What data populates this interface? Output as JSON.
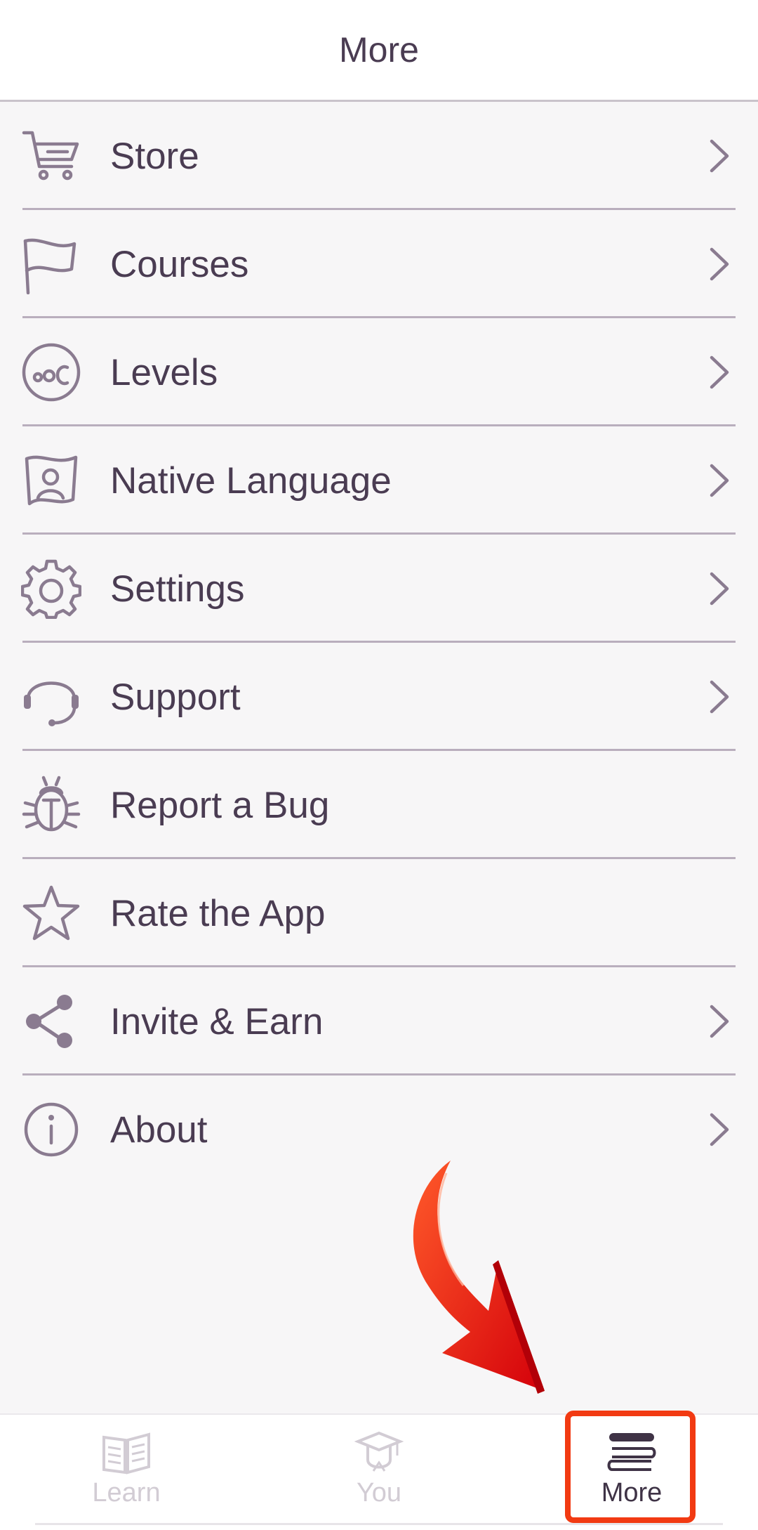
{
  "header": {
    "title": "More"
  },
  "menu": [
    {
      "label": "Store",
      "icon": "cart-icon",
      "chevron": true
    },
    {
      "label": "Courses",
      "icon": "flag-icon",
      "chevron": true
    },
    {
      "label": "Levels",
      "icon": "levels-icon",
      "chevron": true
    },
    {
      "label": "Native Language",
      "icon": "native-language-icon",
      "chevron": true
    },
    {
      "label": "Settings",
      "icon": "gear-icon",
      "chevron": true
    },
    {
      "label": "Support",
      "icon": "headset-icon",
      "chevron": true
    },
    {
      "label": "Report a Bug",
      "icon": "bug-icon",
      "chevron": false
    },
    {
      "label": "Rate the App",
      "icon": "star-icon",
      "chevron": false
    },
    {
      "label": "Invite & Earn",
      "icon": "share-icon",
      "chevron": true
    },
    {
      "label": "About",
      "icon": "info-icon",
      "chevron": true
    }
  ],
  "tabs": [
    {
      "label": "Learn",
      "icon": "book-icon",
      "active": false
    },
    {
      "label": "You",
      "icon": "graduation-cap-icon",
      "active": false
    },
    {
      "label": "More",
      "icon": "menu-stack-icon",
      "active": true
    }
  ],
  "colors": {
    "text": "#4a3c52",
    "icon": "#8a7b90",
    "highlight": "#f23a12"
  }
}
